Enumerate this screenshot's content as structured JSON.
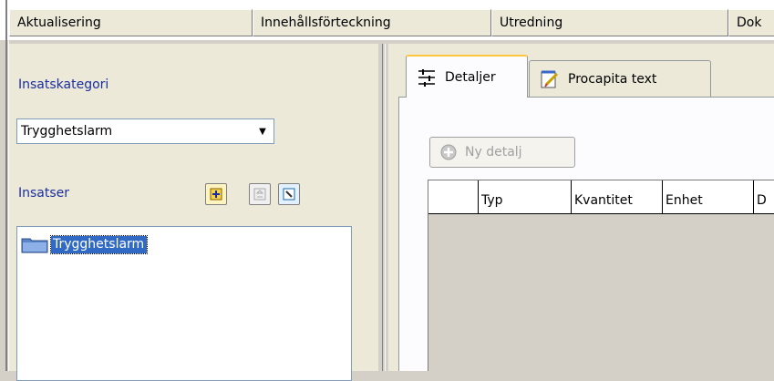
{
  "top_columns": [
    "Aktualisering",
    "Innehållsförteckning",
    "Utredning",
    "Dok"
  ],
  "left": {
    "category_label": "Insatskategori",
    "category_value": "Trygghetslarm",
    "insatser_label": "Insatser",
    "tree_items": [
      "Trygghetslarm"
    ],
    "toolbar_icons": [
      "add-insats-icon",
      "remove-insats-icon",
      "edit-insats-icon"
    ]
  },
  "right": {
    "tabs": [
      {
        "label": "Detaljer",
        "icon": "details-icon",
        "active": true
      },
      {
        "label": "Procapita text",
        "icon": "notepad-pencil-icon",
        "active": false
      }
    ],
    "new_detail_button": "Ny detalj",
    "grid_columns": [
      "",
      "Typ",
      "Kvantitet",
      "Enhet",
      "D"
    ]
  },
  "colors": {
    "selection": "#316ac5",
    "label_blue": "#1a2ea0",
    "tab_highlight": "#ffc83c"
  }
}
